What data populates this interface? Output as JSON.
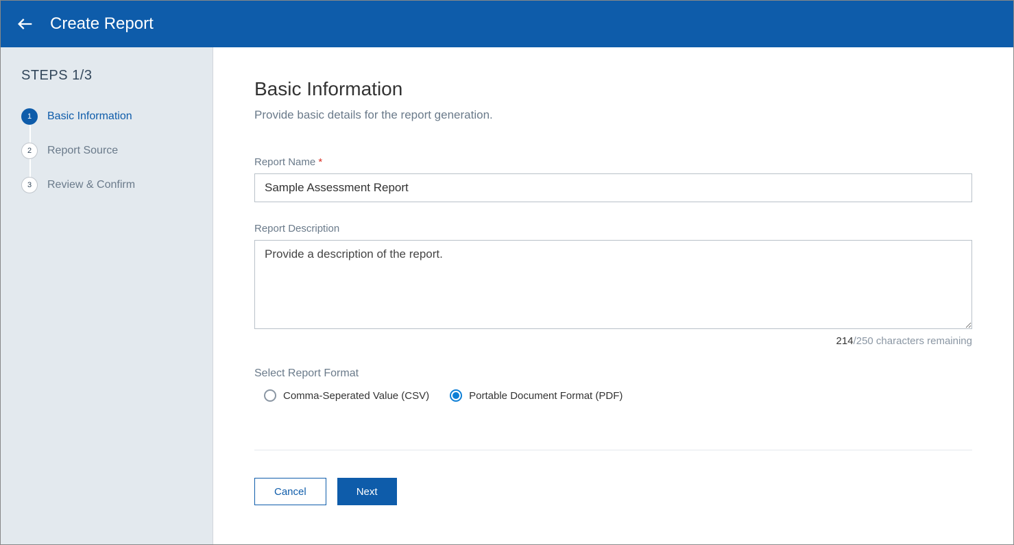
{
  "header": {
    "title": "Create Report"
  },
  "sidebar": {
    "steps_heading": "STEPS 1/3",
    "steps": [
      {
        "num": "1",
        "label": "Basic Information",
        "active": true
      },
      {
        "num": "2",
        "label": "Report Source",
        "active": false
      },
      {
        "num": "3",
        "label": "Review & Confirm",
        "active": false
      }
    ]
  },
  "main": {
    "title": "Basic Information",
    "subtitle": "Provide basic details for the report generation.",
    "report_name_label": "Report Name",
    "report_name_value": "Sample Assessment Report",
    "report_desc_label": "Report Description",
    "report_desc_placeholder": "Provide a description of the report.",
    "char_counter_count": "214",
    "char_counter_rest": "/250 characters remaining",
    "format_label": "Select Report Format",
    "format_options": [
      {
        "label": "Comma-Seperated Value (CSV)",
        "selected": false
      },
      {
        "label": "Portable Document Format (PDF)",
        "selected": true
      }
    ],
    "cancel_label": "Cancel",
    "next_label": "Next"
  }
}
